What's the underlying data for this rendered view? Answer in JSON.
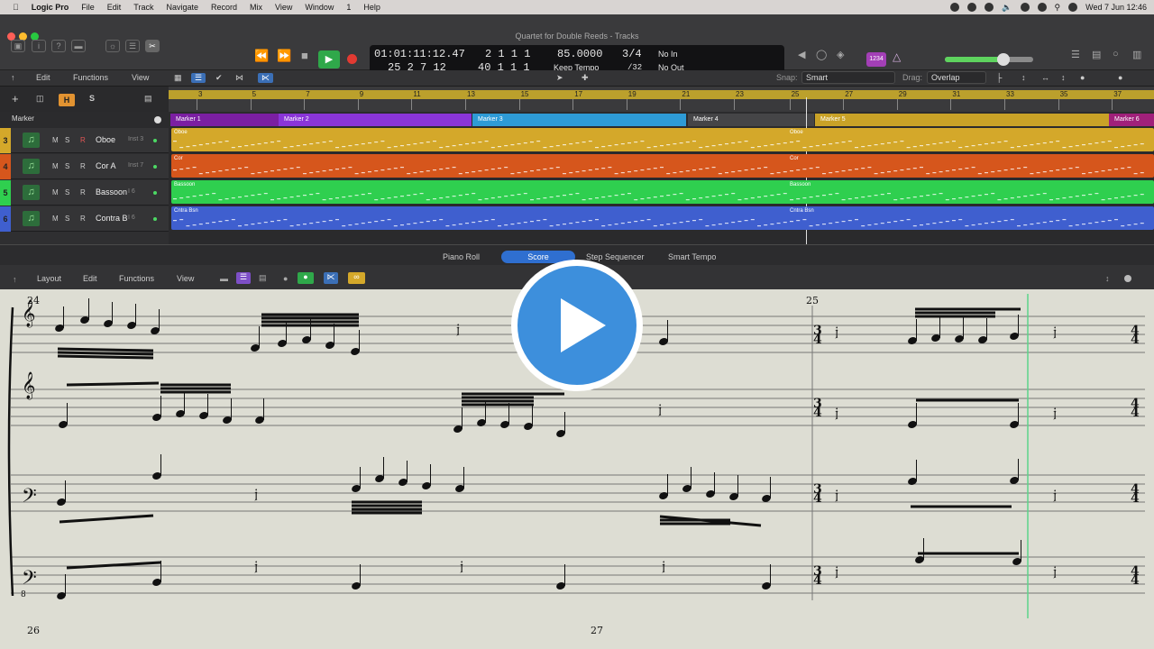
{
  "menubar": {
    "app": "Logic Pro",
    "items": [
      "File",
      "Edit",
      "Track",
      "Navigate",
      "Record",
      "Mix",
      "View",
      "Window",
      "1",
      "Help"
    ],
    "datetime": "Wed 7 Jun  12:46"
  },
  "window": {
    "title": "Quartet for Double Reeds - Tracks"
  },
  "lcd": {
    "time": "01:01:11:12.47",
    "pos_bars": "25  2  7    12",
    "pos_top": "2  1  1      1",
    "pos_bot": "40  1  1      1",
    "tempo": "85.0000",
    "tempo_mode": "Keep Tempo",
    "sig": "3/4",
    "div": "/32",
    "in": "No In",
    "out": "No Out"
  },
  "toolbar": {
    "edit": "Edit",
    "functions": "Functions",
    "view": "View",
    "snap_label": "Snap:",
    "snap": "Smart",
    "drag_label": "Drag:",
    "drag": "Overlap",
    "badge": "1234"
  },
  "tracks": [
    {
      "num": "3",
      "name": "Oboe",
      "inst": "Inst 3",
      "color": "#d4a82a",
      "region": "Oboe"
    },
    {
      "num": "4",
      "name": "Cor A",
      "inst": "Inst 7",
      "color": "#d6561c",
      "region": "Cor"
    },
    {
      "num": "5",
      "name": "Bassoon",
      "inst": "I 6",
      "color": "#2fcf4f",
      "region": "Bassoon"
    },
    {
      "num": "6",
      "name": "Contra B",
      "inst": "I 6",
      "color": "#3f5fcf",
      "region": "Cntra Bsn"
    }
  ],
  "track_buttons": {
    "m": "M",
    "s": "S",
    "r": "R",
    "h": "H"
  },
  "marker_label": "Marker",
  "ruler": {
    "bars": [
      "3",
      "5",
      "7",
      "9",
      "11",
      "13",
      "15",
      "17",
      "19",
      "21",
      "23",
      "25",
      "27",
      "29",
      "31",
      "33",
      "35",
      "37"
    ]
  },
  "markers": [
    {
      "label": "Marker 1",
      "color": "#7b1fa2"
    },
    {
      "label": "Marker 2",
      "color": "#8a35d8"
    },
    {
      "label": "Marker 3",
      "color": "#2e9bd6"
    },
    {
      "label": "Marker 4",
      "color": "#454547"
    },
    {
      "label": "Marker 5",
      "color": "#c9a227"
    },
    {
      "label": "Marker 6",
      "color": "#a0207a"
    }
  ],
  "editor": {
    "tabs": [
      "Piano Roll",
      "Score",
      "Step Sequencer",
      "Smart Tempo"
    ],
    "active": "Score",
    "layout": "Layout",
    "edit": "Edit",
    "functions": "Functions",
    "view": "View"
  },
  "score": {
    "bar_24": "24",
    "bar_25": "25",
    "bar_26": "26",
    "bar_27": "27",
    "clef8": "8",
    "timesig_34": "3/4",
    "timesig_44": "4/4"
  }
}
